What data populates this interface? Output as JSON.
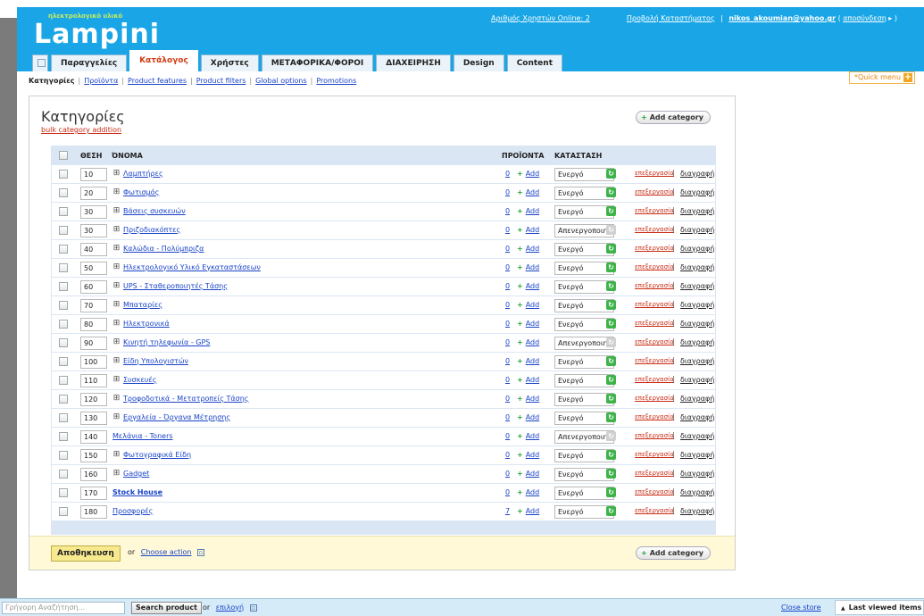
{
  "header": {
    "logo_tagline": "ηλεκτρολογικό υλικό",
    "logo_text": "Lampini",
    "online_users": "Αριθμός Χρηστών Online: 2",
    "view_store": "Προβολή Καταστήματος",
    "user_email": "nikos_akoumian@yahoo.gr",
    "logout": "αποσύνδεση"
  },
  "tabs": [
    {
      "label": "Παραγγελίες"
    },
    {
      "label": "Κατάλογος"
    },
    {
      "label": "Χρήστες"
    },
    {
      "label": "ΜΕΤΑΦΟΡΙΚΑ/ΦΟΡΟΙ"
    },
    {
      "label": "ΔΙΑΧΕΙΡΗΣΗ"
    },
    {
      "label": "Design"
    },
    {
      "label": "Content"
    }
  ],
  "subnav": {
    "current": "Κατηγορίες",
    "links": [
      "Προϊόντα",
      "Product features",
      "Product filters",
      "Global options",
      "Promotions"
    ]
  },
  "quick_menu": "Quick menu",
  "page": {
    "title": "Κατηγορίες",
    "bulk_link": "bulk category addition",
    "add_category": "Add category"
  },
  "table": {
    "headers": {
      "position": "ΘΕΣΗ",
      "name": "ΌΝΟΜΑ",
      "products": "ΠΡΟΪΟΝΤΑ",
      "status": "ΚΑΤΑΣΤΑΣΗ"
    },
    "add_label": "Add",
    "edit_label": "επεξεργασία",
    "delete_label": "διαγραφή",
    "rows": [
      {
        "position": "10",
        "name": "Λαμπτήρες",
        "products": "0",
        "status": "Ενεργό",
        "expandable": true,
        "bold": false
      },
      {
        "position": "20",
        "name": "Φωτισμός",
        "products": "0",
        "status": "Ενεργό",
        "expandable": true,
        "bold": false
      },
      {
        "position": "30",
        "name": "Βάσεις συσκευών",
        "products": "0",
        "status": "Ενεργό",
        "expandable": true,
        "bold": false
      },
      {
        "position": "30",
        "name": "Πριζοδιακόπτες",
        "products": "0",
        "status": "Απενεργοποιημένο",
        "expandable": true,
        "bold": false
      },
      {
        "position": "40",
        "name": "Καλώδια - Πολύμπριζα",
        "products": "0",
        "status": "Ενεργό",
        "expandable": true,
        "bold": false
      },
      {
        "position": "50",
        "name": "Ηλεκτρολογικό Υλικό Εγκαταστάσεων",
        "products": "0",
        "status": "Ενεργό",
        "expandable": true,
        "bold": false
      },
      {
        "position": "60",
        "name": "UPS - Σταθεροποιητές Τάσης",
        "products": "0",
        "status": "Ενεργό",
        "expandable": true,
        "bold": false
      },
      {
        "position": "70",
        "name": "Μπαταρίες",
        "products": "0",
        "status": "Ενεργό",
        "expandable": true,
        "bold": false
      },
      {
        "position": "80",
        "name": "Ηλεκτρονικά",
        "products": "0",
        "status": "Ενεργό",
        "expandable": true,
        "bold": false
      },
      {
        "position": "90",
        "name": "Κινητή τηλεφωνία - GPS",
        "products": "0",
        "status": "Απενεργοποιημένο",
        "expandable": true,
        "bold": false
      },
      {
        "position": "100",
        "name": "Είδη Υπολογιστών",
        "products": "0",
        "status": "Ενεργό",
        "expandable": true,
        "bold": false
      },
      {
        "position": "110",
        "name": "Συσκευές",
        "products": "0",
        "status": "Ενεργό",
        "expandable": true,
        "bold": false
      },
      {
        "position": "120",
        "name": "Τροφοδοτικά - Μετατροπείς Τάσης",
        "products": "0",
        "status": "Ενεργό",
        "expandable": true,
        "bold": false
      },
      {
        "position": "130",
        "name": "Εργαλεία - Όργανα Μέτρησης",
        "products": "0",
        "status": "Ενεργό",
        "expandable": true,
        "bold": false
      },
      {
        "position": "140",
        "name": "Μελάνια - Toners",
        "products": "0",
        "status": "Απενεργοποιημένο",
        "expandable": false,
        "bold": false
      },
      {
        "position": "150",
        "name": "Φωτογραφικά Είδη",
        "products": "0",
        "status": "Ενεργό",
        "expandable": true,
        "bold": false
      },
      {
        "position": "160",
        "name": "Gadget",
        "products": "0",
        "status": "Ενεργό",
        "expandable": true,
        "bold": false
      },
      {
        "position": "170",
        "name": "Stock House",
        "products": "0",
        "status": "Ενεργό",
        "expandable": false,
        "bold": true
      },
      {
        "position": "180",
        "name": "Προσφορές",
        "products": "7",
        "status": "Ενεργό",
        "expandable": false,
        "bold": false
      }
    ]
  },
  "footer": {
    "save_label": "Αποθηκευση",
    "or": "or",
    "choose_action": "Choose action"
  },
  "bottom_bar": {
    "search_placeholder": "Γρήγορη Αναζήτηση...",
    "search_button": "Search product",
    "or": "or",
    "choice_link": "επιλογή",
    "close_store": "Close store",
    "last_viewed": "Last viewed items"
  },
  "colors": {
    "header_blue": "#1aa6e6",
    "active_tab_text": "#d13b12",
    "status_on": "#3db34a"
  }
}
